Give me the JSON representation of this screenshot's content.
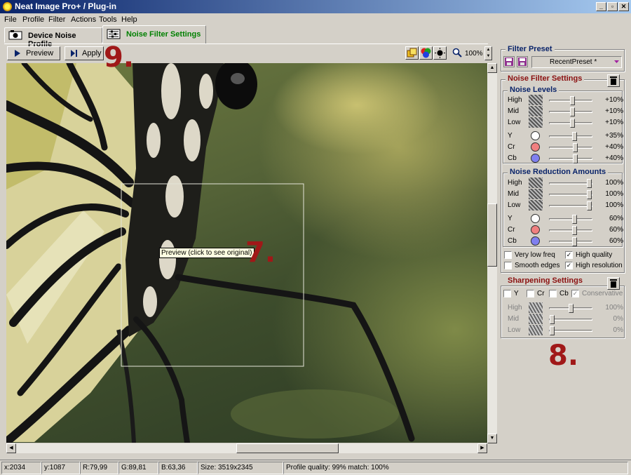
{
  "window": {
    "title": "Neat Image Pro+ / Plug-in",
    "controls": [
      "_",
      "▫",
      "✕"
    ]
  },
  "menu": [
    "File",
    "Profile",
    "Filter",
    "Actions",
    "Tools",
    "Help"
  ],
  "tabs": {
    "device_noise_profile": "Device Noise Profile",
    "noise_filter_settings": "Noise Filter Settings"
  },
  "toolbar": {
    "preview": "Preview",
    "apply": "Apply",
    "zoom": "100%"
  },
  "preview": {
    "tooltip": "Preview (click to see original)"
  },
  "filter_preset": {
    "title": "Filter Preset",
    "value": "RecentPreset *"
  },
  "noise_filter_settings": {
    "title": "Noise Filter Settings",
    "noise_levels": {
      "title": "Noise Levels",
      "rows": [
        {
          "label": "High",
          "value": "+10%",
          "level": 0.55
        },
        {
          "label": "Mid",
          "value": "+10%",
          "level": 0.55
        },
        {
          "label": "Low",
          "value": "+10%",
          "level": 0.55
        },
        {
          "label": "Y",
          "value": "+35%",
          "level": 0.6
        },
        {
          "label": "Cr",
          "value": "+40%",
          "level": 0.62
        },
        {
          "label": "Cb",
          "value": "+40%",
          "level": 0.62
        }
      ]
    },
    "noise_reduction": {
      "title": "Noise Reduction Amounts",
      "rows": [
        {
          "label": "High",
          "value": "100%",
          "level": 1.0
        },
        {
          "label": "Mid",
          "value": "100%",
          "level": 1.0
        },
        {
          "label": "Low",
          "value": "100%",
          "level": 1.0
        },
        {
          "label": "Y",
          "value": "60%",
          "level": 0.6
        },
        {
          "label": "Cr",
          "value": "60%",
          "level": 0.6
        },
        {
          "label": "Cb",
          "value": "60%",
          "level": 0.6
        }
      ]
    },
    "options": {
      "very_low_freq": "Very low freq",
      "high_quality": "High quality",
      "smooth_edges": "Smooth edges",
      "high_resolution": "High resolution"
    }
  },
  "sharpening": {
    "title": "Sharpening Settings",
    "channels": [
      "Y",
      "Cr",
      "Cb",
      "Conservative"
    ],
    "rows": [
      {
        "label": "High",
        "value": "100%",
        "level": 0.5
      },
      {
        "label": "Mid",
        "value": "0%",
        "level": 0.0
      },
      {
        "label": "Low",
        "value": "0%",
        "level": 0.0
      }
    ]
  },
  "status": {
    "x": "x:2034",
    "y": "y:1087",
    "r": "R:79,99",
    "g": "G:89,81",
    "b": "B:63,36",
    "size": "Size: 3519x2345",
    "quality": "Profile quality: 99%  match: 100%"
  },
  "annotations": {
    "a9": "9.",
    "a7": "7.",
    "a8": "8."
  },
  "colors": {
    "title_start": "#0a246a",
    "title_end": "#a6caf0",
    "accent_red": "#8b1010",
    "annotation": "#a01818",
    "tab_active": "#008000"
  }
}
